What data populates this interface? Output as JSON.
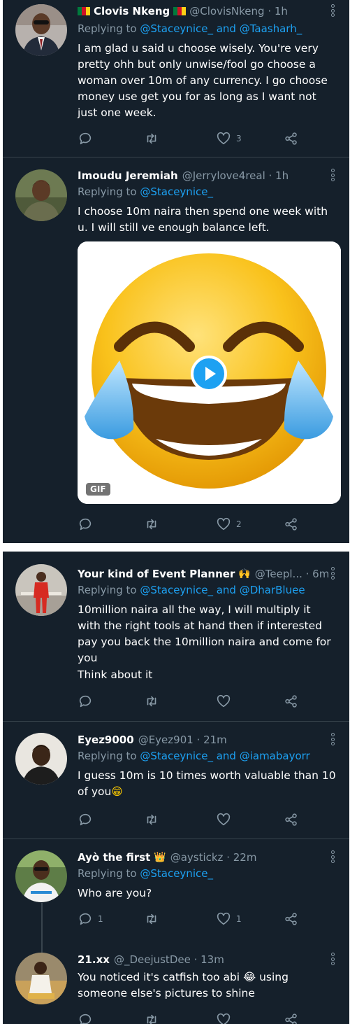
{
  "colors": {
    "background": "#15202b",
    "text": "#ffffff",
    "muted": "#8899a6",
    "link": "#1da1f2",
    "divider": "#38444d"
  },
  "screen1": {
    "tweets": [
      {
        "name": "Clovis Nkeng",
        "flags": [
          "cameroon-flag-icon",
          "cameroon-flag-icon"
        ],
        "handle": "@ClovisNkeng · 1h",
        "replying_prefix": "Replying to",
        "replying_to": "@Staceynice_ and @Taasharh_",
        "body": "I am glad u said u choose wisely. You're very pretty ohh but only unwise/fool go choose a woman over 10m of any currency. I go choose money use get you for as long as I want not just one week.",
        "reply_count": "",
        "retweet_count": "",
        "like_count": "3"
      },
      {
        "name": "Imoudu Jeremiah",
        "handle": "@Jerrylove4real · 1h",
        "replying_prefix": "Replying to",
        "replying_to": "@Staceynice_",
        "body": "I choose 10m naira then spend one week with u. I will still ve enough balance left.",
        "media": {
          "badge": "GIF",
          "type": "laughing-crying-emoji-gif"
        },
        "reply_count": "",
        "retweet_count": "",
        "like_count": "2"
      }
    ]
  },
  "screen2": {
    "tweets": [
      {
        "name": "Your kind of Event Planner",
        "emoji": "🙌",
        "handle": "@Teepl... · 6m",
        "replying_prefix": "Replying to",
        "replying_to": "@Staceynice_ and @DharBluee",
        "body": "10million naira all the way, I will multiply it with the right tools at hand then if interested pay you back the 10million naira and come for you",
        "body2": "Think about it",
        "reply_count": "",
        "retweet_count": "",
        "like_count": ""
      },
      {
        "name": "Eyez9000",
        "handle": "@Eyez901 · 21m",
        "replying_prefix": "Replying to",
        "replying_to": "@Staceynice_ and @iamabayorr",
        "body": "I guess 10m is 10 times worth valuable than 10 of you",
        "body_emoji": "😁",
        "reply_count": "",
        "retweet_count": "",
        "like_count": ""
      },
      {
        "name": "Ayò the first",
        "emoji": "👑",
        "handle": "@aystickz · 22m",
        "replying_prefix": "Replying to",
        "replying_to": "@Staceynice_",
        "body": "Who are you?",
        "reply_count": "1",
        "retweet_count": "",
        "like_count": "1"
      },
      {
        "name": "21.xx",
        "handle": "@_DeejustDee · 13m",
        "body": "You noticed it's catfish too abi 😂 using someone else's pictures to shine",
        "reply_count": "",
        "retweet_count": "",
        "like_count": ""
      }
    ]
  }
}
